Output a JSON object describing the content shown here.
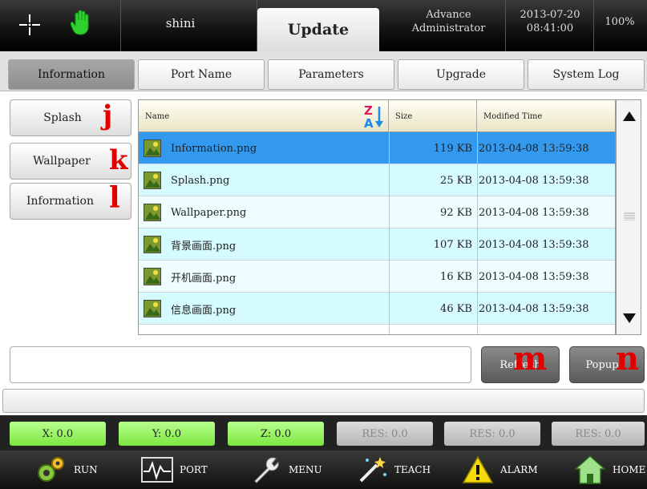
{
  "topbar": {
    "user": "shini",
    "screen_title": "Update",
    "role_line1": "Advance",
    "role_line2": "Administrator",
    "date": "2013-07-20",
    "time": "08:41:00",
    "battery": "100%",
    "icons": [
      "crosshair-icon",
      "hand-icon"
    ]
  },
  "tabs": [
    {
      "label": "Information",
      "active": true
    },
    {
      "label": "Port Name",
      "active": false
    },
    {
      "label": "Parameters",
      "active": false
    },
    {
      "label": "Upgrade",
      "active": false
    },
    {
      "label": "System Log",
      "active": false
    }
  ],
  "side_buttons": [
    {
      "label": "Splash",
      "marker": "j"
    },
    {
      "label": "Wallpaper",
      "marker": "k"
    },
    {
      "label": "Information",
      "marker": "l"
    }
  ],
  "file_table": {
    "columns": [
      "Name",
      "Size",
      "Modified Time"
    ],
    "sort_icon": "sort-za-icon",
    "rows": [
      {
        "name": "Information.png",
        "size": "119 KB",
        "modified": "2013-04-08 13:59:38",
        "selected": true
      },
      {
        "name": "Splash.png",
        "size": "25 KB",
        "modified": "2013-04-08 13:59:38",
        "selected": false
      },
      {
        "name": "Wallpaper.png",
        "size": "92 KB",
        "modified": "2013-04-08 13:59:38",
        "selected": false
      },
      {
        "name": "背景画面.png",
        "size": "107 KB",
        "modified": "2013-04-08 13:59:38",
        "selected": false
      },
      {
        "name": "开机画面.png",
        "size": "16 KB",
        "modified": "2013-04-08 13:59:38",
        "selected": false
      },
      {
        "name": "信息画面.png",
        "size": "46 KB",
        "modified": "2013-04-08 13:59:38",
        "selected": false
      }
    ]
  },
  "actions": {
    "refresh": "Refresh",
    "refresh_marker": "m",
    "popup": "Popup",
    "popup_marker": "n"
  },
  "coords": [
    {
      "label": "X: 0.0",
      "enabled": true
    },
    {
      "label": "Y: 0.0",
      "enabled": true
    },
    {
      "label": "Z: 0.0",
      "enabled": true
    },
    {
      "label": "RES: 0.0",
      "enabled": false
    },
    {
      "label": "RES: 0.0",
      "enabled": false
    },
    {
      "label": "RES: 0.0",
      "enabled": false
    }
  ],
  "nav": [
    {
      "label": "RUN",
      "icon": "gears-icon"
    },
    {
      "label": "PORT",
      "icon": "waveform-icon"
    },
    {
      "label": "MENU",
      "icon": "wrench-icon"
    },
    {
      "label": "TEACH",
      "icon": "wand-icon"
    },
    {
      "label": "ALARM",
      "icon": "warning-icon"
    },
    {
      "label": "HOME",
      "icon": "home-icon"
    }
  ],
  "colors": {
    "selected_row": "#3399ee",
    "alt_row": "#d6fbff",
    "row": "#eefdff",
    "marker": "#e00000",
    "coord_on": "#8cee50"
  }
}
